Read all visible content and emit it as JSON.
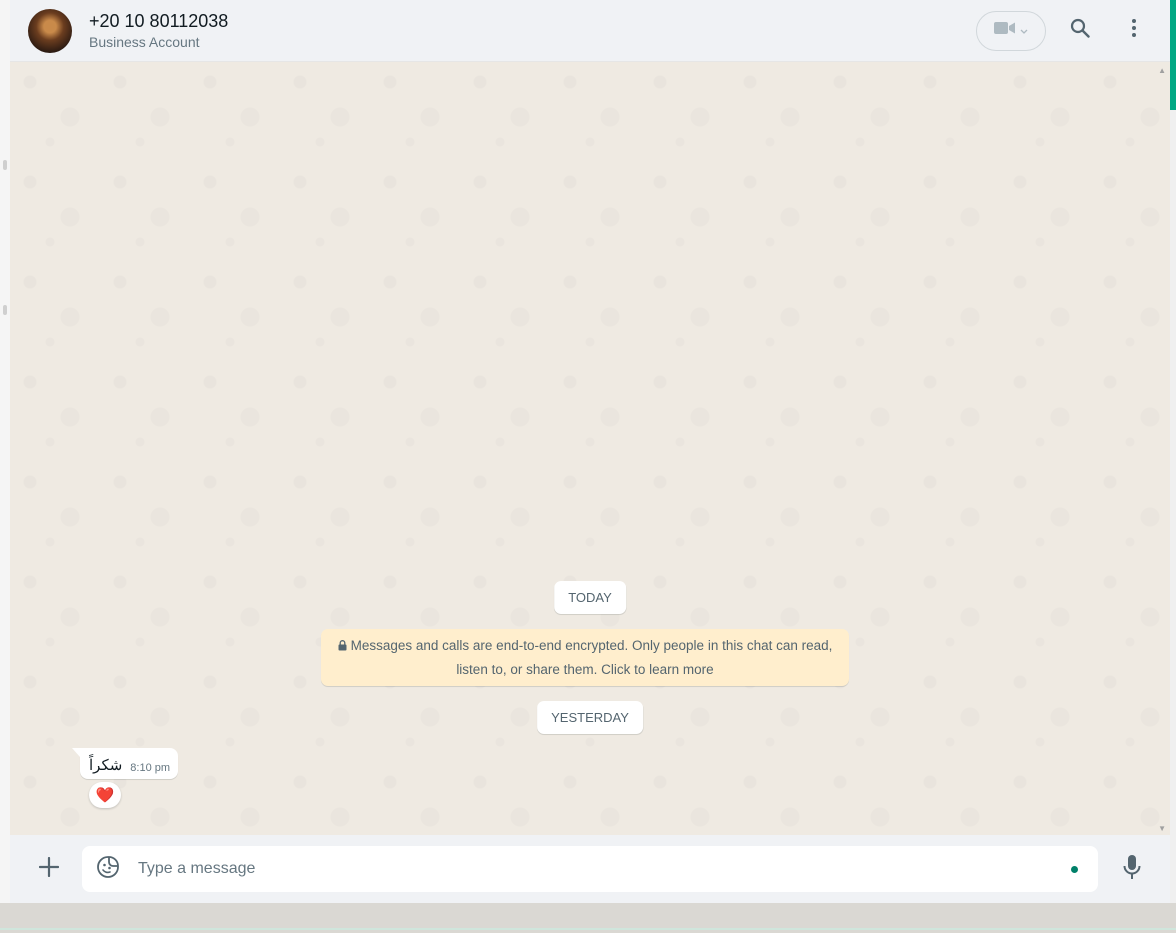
{
  "header": {
    "contact_name": "+20 10 80112038",
    "subtitle": "Business Account",
    "avatar_icon": "contact-avatar",
    "video_icon": "video-camera-icon",
    "search_icon": "search-icon",
    "menu_icon": "more-vertical-icon"
  },
  "messages": {
    "date_today": "TODAY",
    "encryption_notice": "Messages and calls are end-to-end encrypted. Only people in this chat can read, listen to, or share them. Click to learn more",
    "date_yesterday": "YESTERDAY",
    "items": [
      {
        "text": "شكراً",
        "time": "8:10 pm",
        "reaction": "❤️"
      }
    ]
  },
  "composer": {
    "placeholder": "Type a message",
    "attach_icon": "plus-icon",
    "emoji_icon": "sticker-icon",
    "mic_icon": "microphone-icon"
  },
  "colors": {
    "accent": "#00a884",
    "notice_bg": "#ffeecd",
    "chat_bg": "#efeae2",
    "header_bg": "#f0f2f5"
  }
}
